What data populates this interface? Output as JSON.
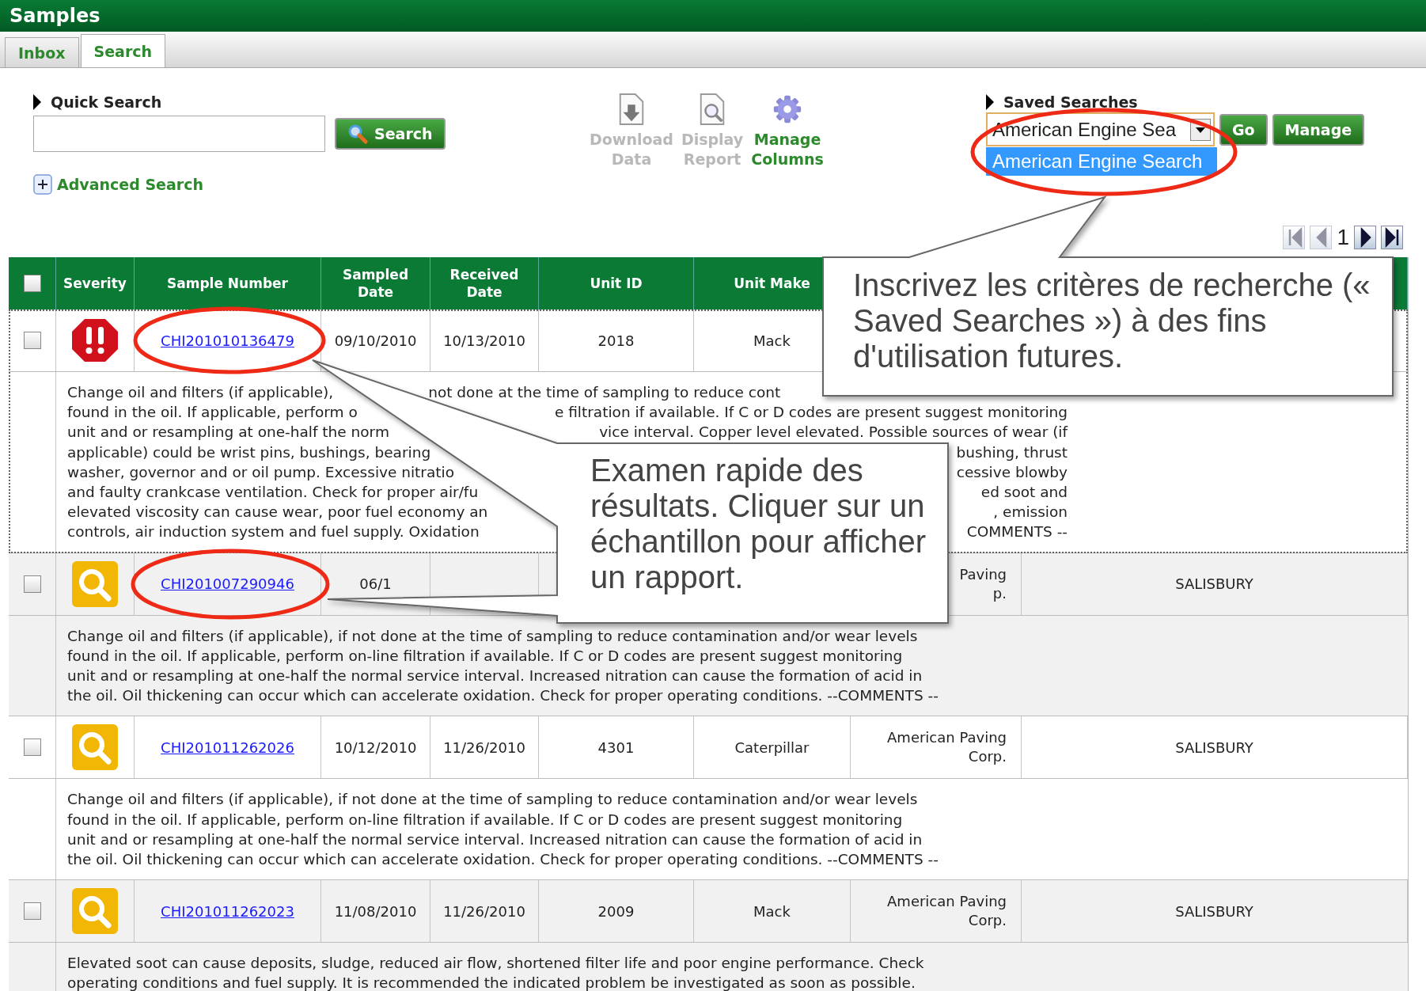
{
  "window": {
    "title": "Samples"
  },
  "tabs": [
    {
      "label": "Inbox",
      "selected": false
    },
    {
      "label": "Search",
      "selected": true
    }
  ],
  "quick_search": {
    "label": "Quick Search",
    "button": "Search"
  },
  "advanced_search": {
    "label": "Advanced Search"
  },
  "toolbar": [
    {
      "kind": "download",
      "label": "Download Data",
      "disabled": true
    },
    {
      "kind": "report",
      "label": "Display Report",
      "disabled": true
    },
    {
      "kind": "columns",
      "label": "Manage Columns",
      "disabled": false
    }
  ],
  "saved_searches": {
    "label": "Saved Searches",
    "value": "American Engine Sea",
    "options": [
      {
        "label": "American Engine Search",
        "selected": true
      }
    ],
    "go": "Go",
    "manage": "Manage"
  },
  "pager": {
    "buttons": [
      {
        "kind": "first",
        "disabled": true
      },
      {
        "kind": "prev",
        "disabled": true
      },
      {
        "kind": "next",
        "disabled": false
      },
      {
        "kind": "last",
        "disabled": false
      }
    ],
    "page": "1"
  },
  "table": {
    "header_checkbox": {
      "checked": false
    },
    "columns": [
      "Severity",
      "Sample Number",
      "Sampled Date",
      "Received Date",
      "Unit ID",
      "Unit Make"
    ],
    "rows": [
      {
        "checked": false,
        "focused": true,
        "severity": {
          "kind": "critical"
        },
        "sample_number": "CHI201010136479",
        "sampled_date": "09/10/2010",
        "received_date": "10/13/2010",
        "unit_id": "2018",
        "unit_make": "Mack",
        "comment_fragments": [
          [
            "Change oil and filters (if applicable),",
            "not done at the time of sampling to reduce cont"
          ],
          [
            "found in the oil. If applicable, perform o",
            "e filtration if available. If C or D codes are present suggest monitoring"
          ],
          [
            "unit and or resampling at one-half the norm",
            "vice interval. Copper level elevated. Possible sources of wear (if"
          ],
          [
            "applicable) could be wrist pins, bushings, bearing",
            "bushing, thrust"
          ],
          [
            "washer, governor and or oil pump. Excessive nitratio",
            "cessive blowby"
          ],
          [
            "and faulty crankcase ventilation. Check for proper air/fu",
            "ed soot and"
          ],
          [
            "elevated viscosity can cause wear, poor fuel economy an",
            ", emission"
          ],
          [
            "controls, air induction system and fuel supply. Oxidation",
            "COMMENTS --"
          ]
        ]
      },
      {
        "checked": false,
        "focused": false,
        "severity": {
          "kind": "caution"
        },
        "sample_number": "CHI201007290946",
        "sampled_date": "06/1",
        "customer": [
          "Paving",
          "p."
        ],
        "location": "SALISBURY",
        "comment": [
          "Change oil and filters (if applicable), if not done at the time of sampling to reduce contamination and/or wear levels",
          "found in the oil. If applicable, perform on-line filtration if available. If C or D codes are present suggest monitoring",
          "unit and or resampling at one-half the normal service interval. Increased nitration can cause the formation of acid in",
          "the oil. Oil thickening can occur which can accelerate oxidation. Check for proper operating conditions. --COMMENTS --"
        ]
      },
      {
        "checked": false,
        "focused": false,
        "severity": {
          "kind": "caution"
        },
        "sample_number": "CHI201011262026",
        "sampled_date": "10/12/2010",
        "received_date": "11/26/2010",
        "unit_id": "4301",
        "unit_make": "Caterpillar",
        "customer": [
          "American Paving",
          "Corp."
        ],
        "location": "SALISBURY",
        "comment": [
          "Change oil and filters (if applicable), if not done at the time of sampling to reduce contamination and/or wear levels",
          "found in the oil. If applicable, perform on-line filtration if available. If C or D codes are present suggest monitoring",
          "unit and or resampling at one-half the normal service interval. Increased nitration can cause the formation of acid in",
          "the oil. Oil thickening can occur which can accelerate oxidation. Check for proper operating conditions. --COMMENTS --"
        ]
      },
      {
        "checked": false,
        "focused": false,
        "severity": {
          "kind": "caution"
        },
        "sample_number": "CHI201011262023",
        "sampled_date": "11/08/2010",
        "received_date": "11/26/2010",
        "unit_id": "2009",
        "unit_make": "Mack",
        "customer": [
          "American Paving",
          "Corp."
        ],
        "location": "SALISBURY",
        "comment": [
          "Elevated soot can cause deposits, sludge, reduced air flow, shortened filter life and poor engine performance. Check",
          "operating conditions and fuel supply. It is recommended the indicated problem be investigated as soon as possible."
        ]
      }
    ]
  },
  "callouts": [
    {
      "text": "Inscrivez les critères de recherche (« Saved Searches ») à des fins d'utilisation futures."
    },
    {
      "text": "Examen rapide des résultats. Cliquer sur un échantillon pour afficher un rapport."
    }
  ]
}
